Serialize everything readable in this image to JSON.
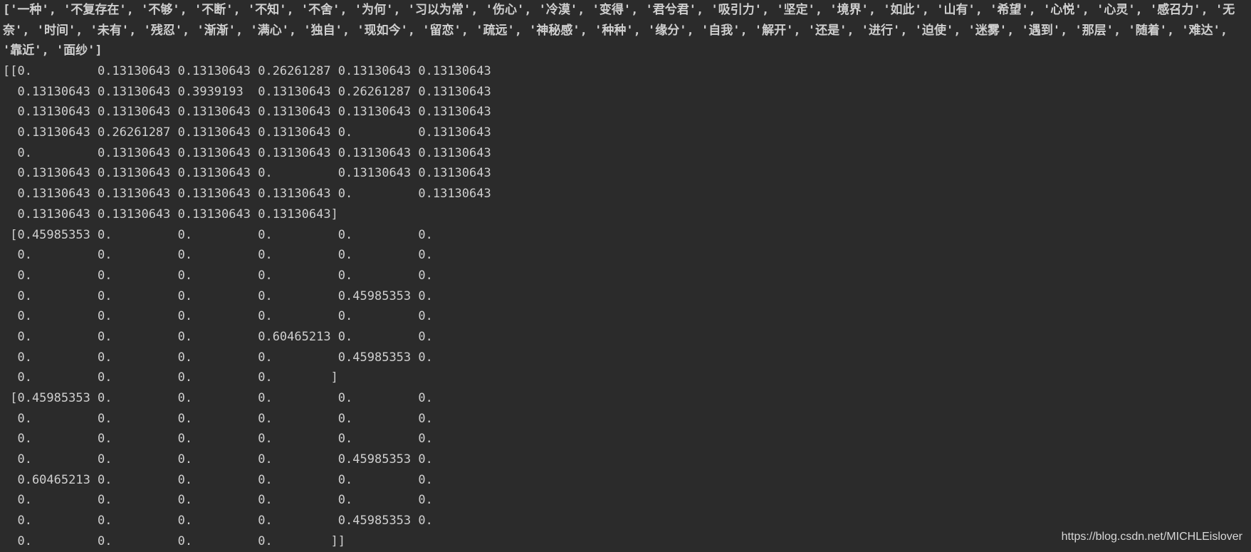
{
  "output": {
    "words_line": "['一种', '不复存在', '不够', '不断', '不知', '不舍', '为何', '习以为常', '伤心', '冷漠', '变得', '君兮君', '吸引力', '坚定', '境界', '如此', '山有', '希望', '心悦', '心灵', '感召力', '无奈', '时间', '未有', '残忍', '渐渐', '满心', '独自', '现如今', '留恋', '疏远', '神秘感', '种种', '缘分', '自我', '解开', '还是', '进行', '迫使', '迷雾', '遇到', '那层', '随着', '难达', '靠近', '面纱']",
    "matrix_lines": [
      "[[0.         0.13130643 0.13130643 0.26261287 0.13130643 0.13130643",
      "  0.13130643 0.13130643 0.3939193  0.13130643 0.26261287 0.13130643",
      "  0.13130643 0.13130643 0.13130643 0.13130643 0.13130643 0.13130643",
      "  0.13130643 0.26261287 0.13130643 0.13130643 0.         0.13130643",
      "  0.         0.13130643 0.13130643 0.13130643 0.13130643 0.13130643",
      "  0.13130643 0.13130643 0.13130643 0.         0.13130643 0.13130643",
      "  0.13130643 0.13130643 0.13130643 0.13130643 0.         0.13130643",
      "  0.13130643 0.13130643 0.13130643 0.13130643]",
      " [0.45985353 0.         0.         0.         0.         0.",
      "  0.         0.         0.         0.         0.         0.",
      "  0.         0.         0.         0.         0.         0.",
      "  0.         0.         0.         0.         0.45985353 0.",
      "  0.         0.         0.         0.         0.         0.",
      "  0.         0.         0.         0.60465213 0.         0.",
      "  0.         0.         0.         0.         0.45985353 0.",
      "  0.         0.         0.         0.        ]",
      " [0.45985353 0.         0.         0.         0.         0.",
      "  0.         0.         0.         0.         0.         0.",
      "  0.         0.         0.         0.         0.         0.",
      "  0.         0.         0.         0.         0.45985353 0.",
      "  0.60465213 0.         0.         0.         0.         0.",
      "  0.         0.         0.         0.         0.         0.",
      "  0.         0.         0.         0.         0.45985353 0.",
      "  0.         0.         0.         0.        ]]"
    ]
  },
  "watermark": "https://blog.csdn.net/MICHLEislover"
}
